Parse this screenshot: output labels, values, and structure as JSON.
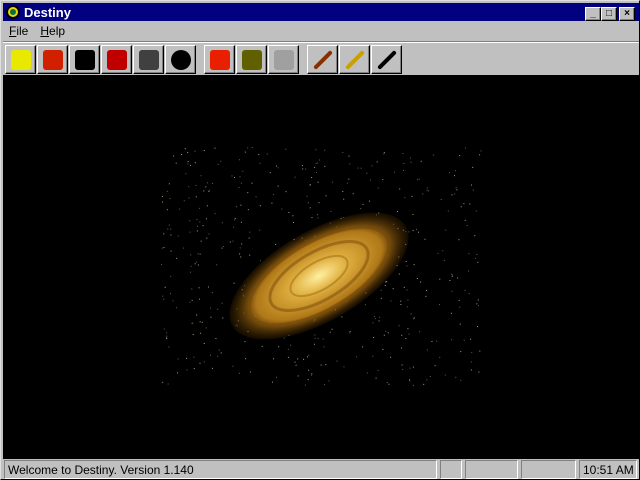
{
  "window": {
    "title": "Destiny",
    "minimize": "_",
    "maximize": "□",
    "close": "×"
  },
  "menu": [
    {
      "label": "File",
      "accel": "F",
      "rest": "ile"
    },
    {
      "label": "Help",
      "accel": "H",
      "rest": "elp"
    }
  ],
  "toolbar": [
    {
      "name": "temple-icon",
      "color": "#e8e800"
    },
    {
      "name": "smelting-icon",
      "color": "#d02000"
    },
    {
      "name": "anvil-icon",
      "color": "#000000"
    },
    {
      "name": "forge-icon",
      "color": "#c00000"
    },
    {
      "name": "machine-icon",
      "color": "#404040"
    },
    {
      "name": "bomb-icon",
      "color": "#000000"
    },
    {
      "name": "explosion-icon",
      "color": "#e82000"
    },
    {
      "name": "railroad-icon",
      "color": "#606000"
    },
    {
      "name": "road-icon",
      "color": "#a0a0a0",
      "disabled": true
    },
    {
      "name": "club-icon",
      "color": "#8a3000"
    },
    {
      "name": "sword-icon",
      "color": "#c8a000"
    },
    {
      "name": "rapier-icon",
      "color": "#000000"
    }
  ],
  "status": {
    "message": "Welcome to Destiny. Version 1.140",
    "time": "10:51 AM"
  }
}
